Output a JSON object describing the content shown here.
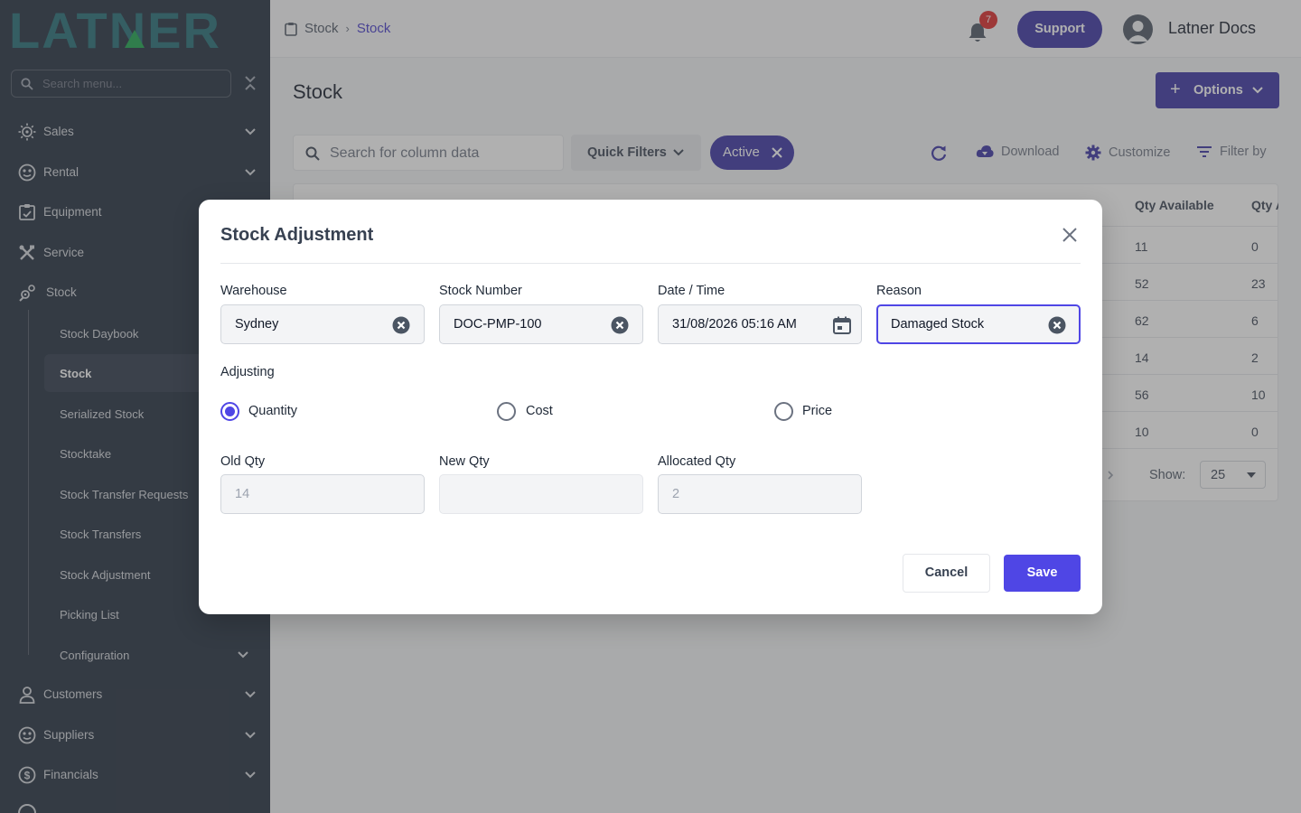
{
  "brand": {
    "logo_text": "LATNER"
  },
  "sidebar": {
    "search_placeholder": "Search menu...",
    "items": [
      {
        "label": "Sales",
        "icon": "sales-icon"
      },
      {
        "label": "Rental",
        "icon": "rental-icon"
      },
      {
        "label": "Equipment",
        "icon": "equipment-icon"
      },
      {
        "label": "Service",
        "icon": "service-icon"
      },
      {
        "label": "Stock",
        "icon": "stock-icon"
      },
      {
        "label": "Customers",
        "icon": "customers-icon"
      },
      {
        "label": "Suppliers",
        "icon": "suppliers-icon"
      },
      {
        "label": "Financials",
        "icon": "financials-icon"
      }
    ],
    "stock_sub": [
      "Stock Daybook",
      "Stock",
      "Serialized Stock",
      "Stocktake",
      "Stock Transfer Requests",
      "Stock Transfers",
      "Stock Adjustment",
      "Picking List",
      "Configuration"
    ],
    "active_sub": "Stock"
  },
  "topbar": {
    "breadcrumb": [
      "Stock",
      "Stock"
    ],
    "notification_count": "7",
    "support_label": "Support",
    "user_name": "Latner Docs"
  },
  "page": {
    "title": "Stock",
    "options_label": "Options",
    "search_placeholder": "Search for column data",
    "quick_filters_label": "Quick Filters",
    "active_chip": "Active",
    "download_label": "Download",
    "customize_label": "Customize",
    "filter_by_label": "Filter by",
    "columns": [
      "Qty Available",
      "Qty A"
    ],
    "rows": [
      [
        "11",
        "0"
      ],
      [
        "52",
        "23"
      ],
      [
        "62",
        "6"
      ],
      [
        "14",
        "2"
      ],
      [
        "56",
        "10"
      ],
      [
        "10",
        "0"
      ]
    ],
    "show_label": "Show:",
    "page_size": "25"
  },
  "modal": {
    "title": "Stock Adjustment",
    "warehouse": {
      "label": "Warehouse",
      "value": "Sydney"
    },
    "stock_number": {
      "label": "Stock Number",
      "value": "DOC-PMP-100"
    },
    "date_time": {
      "label": "Date / Time",
      "value": "31/08/2026 05:16 AM"
    },
    "reason": {
      "label": "Reason",
      "value": "Damaged Stock"
    },
    "adjusting": {
      "label": "Adjusting",
      "options": [
        "Quantity",
        "Cost",
        "Price"
      ],
      "selected": "Quantity"
    },
    "old_qty": {
      "label": "Old Qty",
      "value": "14"
    },
    "new_qty": {
      "label": "New Qty",
      "value": ""
    },
    "allocated_qty": {
      "label": "Allocated Qty",
      "value": "2"
    },
    "cancel_label": "Cancel",
    "save_label": "Save"
  },
  "colors": {
    "sidebar_bg": "#1e2a3b",
    "accent": "#4f46e5",
    "accent_dark": "#3730a3",
    "logo": "#1f6b73"
  }
}
